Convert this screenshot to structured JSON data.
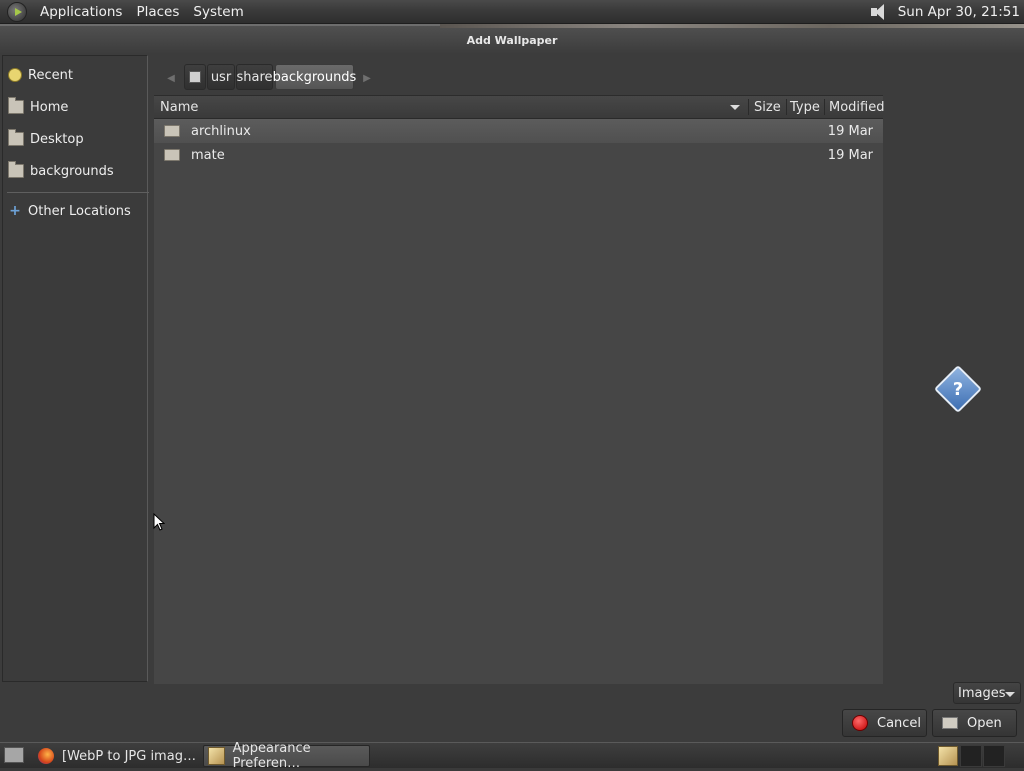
{
  "top_panel": {
    "menus": [
      "Applications",
      "Places",
      "System"
    ],
    "clock": "Sun Apr 30, 21:51"
  },
  "window": {
    "title": "Add Wallpaper"
  },
  "sidebar": {
    "items": [
      {
        "label": "Recent",
        "icon": "recent-icon"
      },
      {
        "label": "Home",
        "icon": "home-folder-icon"
      },
      {
        "label": "Desktop",
        "icon": "desktop-folder-icon"
      },
      {
        "label": "backgrounds",
        "icon": "folder-icon"
      },
      {
        "label": "Other Locations",
        "icon": "plus-icon"
      }
    ]
  },
  "pathbar": {
    "crumbs": [
      "usr",
      "share",
      "backgrounds"
    ],
    "active": "backgrounds"
  },
  "file_list": {
    "columns": [
      "Name",
      "Size",
      "Type",
      "Modified"
    ],
    "rows": [
      {
        "name": "archlinux",
        "size": "",
        "type": "",
        "modified": "19 Mar",
        "selected": true
      },
      {
        "name": "mate",
        "size": "",
        "type": "",
        "modified": "19 Mar",
        "selected": false
      }
    ]
  },
  "filter": {
    "value": "Images"
  },
  "buttons": {
    "cancel": "Cancel",
    "open": "Open"
  },
  "taskbar": {
    "items": [
      {
        "label": "[WebP to JPG imag…",
        "icon": "firefox-icon"
      },
      {
        "label": "Appearance Preferen…",
        "icon": "appearance-icon",
        "active": true
      }
    ]
  },
  "colors": {
    "selection": "#555555",
    "accent": "#3d6fb3"
  }
}
